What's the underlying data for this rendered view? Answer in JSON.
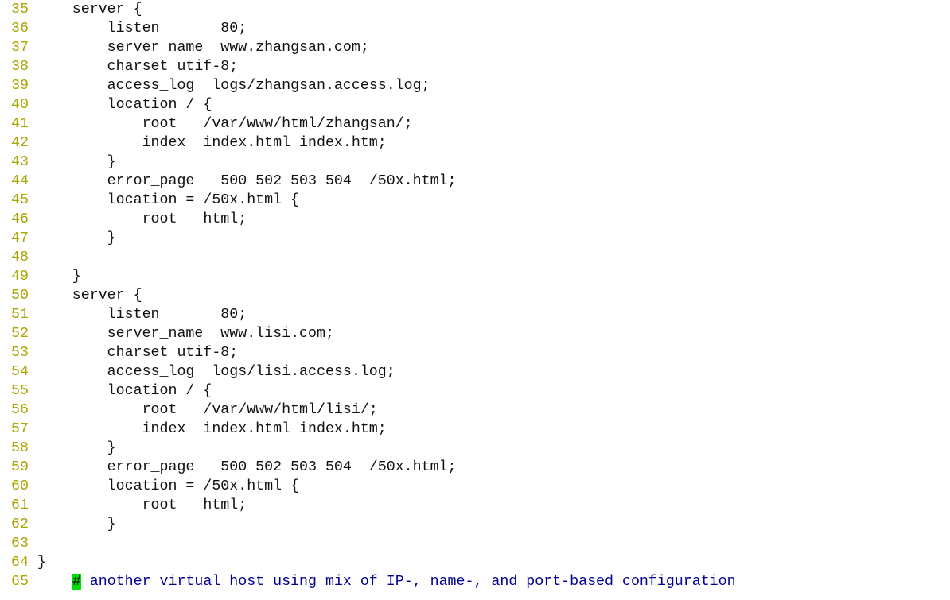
{
  "editor": {
    "colors": {
      "line_number": "#aaa500",
      "comment": "#000090",
      "cursor": "#00e000",
      "text": "#111111"
    },
    "lines": [
      {
        "n": "35",
        "text": "    server {"
      },
      {
        "n": "36",
        "text": "        listen       80;"
      },
      {
        "n": "37",
        "text": "        server_name  www.zhangsan.com;"
      },
      {
        "n": "38",
        "text": "        charset utif-8;"
      },
      {
        "n": "39",
        "text": "        access_log  logs/zhangsan.access.log;"
      },
      {
        "n": "40",
        "text": "        location / {"
      },
      {
        "n": "41",
        "text": "            root   /var/www/html/zhangsan/;"
      },
      {
        "n": "42",
        "text": "            index  index.html index.htm;"
      },
      {
        "n": "43",
        "text": "        }"
      },
      {
        "n": "44",
        "text": "        error_page   500 502 503 504  /50x.html;"
      },
      {
        "n": "45",
        "text": "        location = /50x.html {"
      },
      {
        "n": "46",
        "text": "            root   html;"
      },
      {
        "n": "47",
        "text": "        }"
      },
      {
        "n": "48",
        "text": ""
      },
      {
        "n": "49",
        "text": "    }"
      },
      {
        "n": "50",
        "text": "    server {"
      },
      {
        "n": "51",
        "text": "        listen       80;"
      },
      {
        "n": "52",
        "text": "        server_name  www.lisi.com;"
      },
      {
        "n": "53",
        "text": "        charset utif-8;"
      },
      {
        "n": "54",
        "text": "        access_log  logs/lisi.access.log;"
      },
      {
        "n": "55",
        "text": "        location / {"
      },
      {
        "n": "56",
        "text": "            root   /var/www/html/lisi/;"
      },
      {
        "n": "57",
        "text": "            index  index.html index.htm;"
      },
      {
        "n": "58",
        "text": "        }"
      },
      {
        "n": "59",
        "text": "        error_page   500 502 503 504  /50x.html;"
      },
      {
        "n": "60",
        "text": "        location = /50x.html {"
      },
      {
        "n": "61",
        "text": "            root   html;"
      },
      {
        "n": "62",
        "text": "        }"
      },
      {
        "n": "63",
        "text": ""
      },
      {
        "n": "64",
        "text": "}"
      }
    ],
    "last_line": {
      "n": "65",
      "indent": "    ",
      "cursor_char": "#",
      "comment": " another virtual host using mix of IP-, name-, and port-based configuration"
    }
  }
}
